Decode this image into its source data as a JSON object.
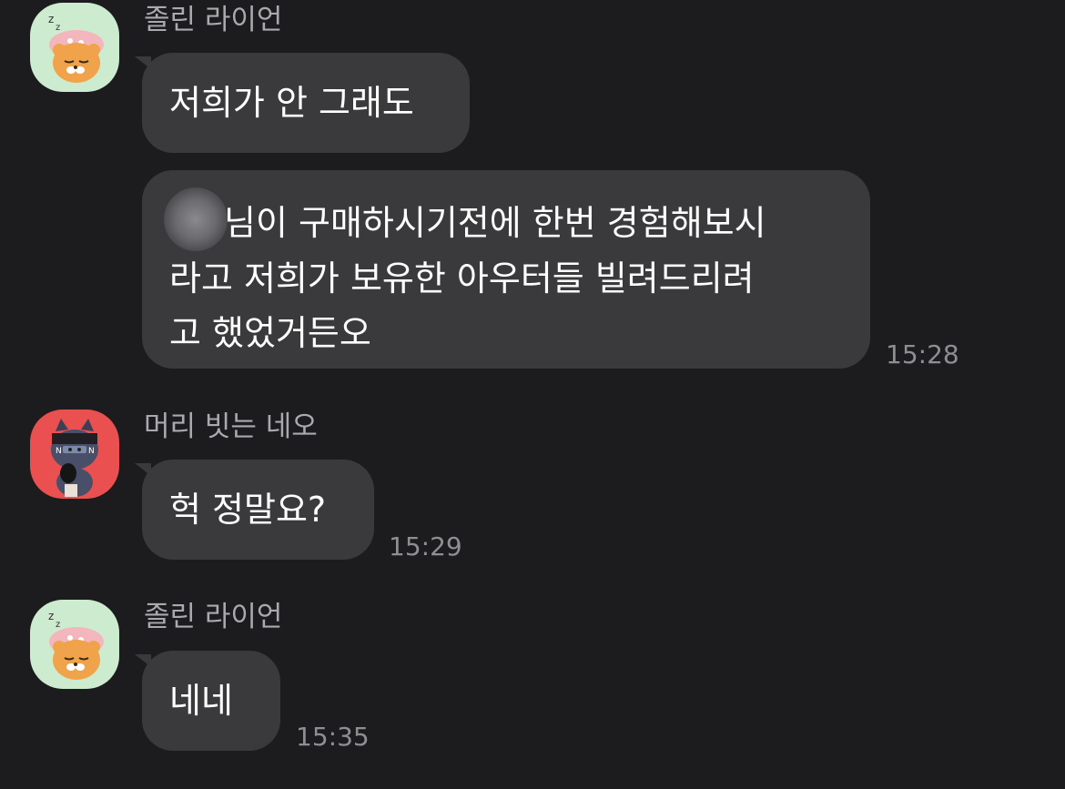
{
  "messages": [
    {
      "sender": "졸린 라이언",
      "avatar": "ryan-sleeping-avatar",
      "bubbles": [
        {
          "lines": [
            "저희가 안 그래도"
          ]
        },
        {
          "lines": [
            "님이 구매하시기전에 한번 경험해보시",
            "라고 저희가 보유한 아우터들 빌려드리려",
            "고 했었거든오"
          ],
          "time": "15:28",
          "redacted_prefix": true
        }
      ]
    },
    {
      "sender": "머리 빗는 네오",
      "avatar": "neo-cat-avatar",
      "bubbles": [
        {
          "lines": [
            "헉 정말요?"
          ],
          "time": "15:29"
        }
      ]
    },
    {
      "sender": "졸린 라이언",
      "avatar": "ryan-sleeping-avatar",
      "bubbles": [
        {
          "lines": [
            "네네"
          ],
          "time": "15:35"
        }
      ]
    }
  ],
  "colors": {
    "background": "#1c1c1e",
    "bubble": "#3a3a3c",
    "sender_text": "#a9a9ae",
    "time_text": "#8e8e93",
    "ryan_avatar_bg": "#cdeccf",
    "neo_avatar_bg": "#e9504f"
  }
}
